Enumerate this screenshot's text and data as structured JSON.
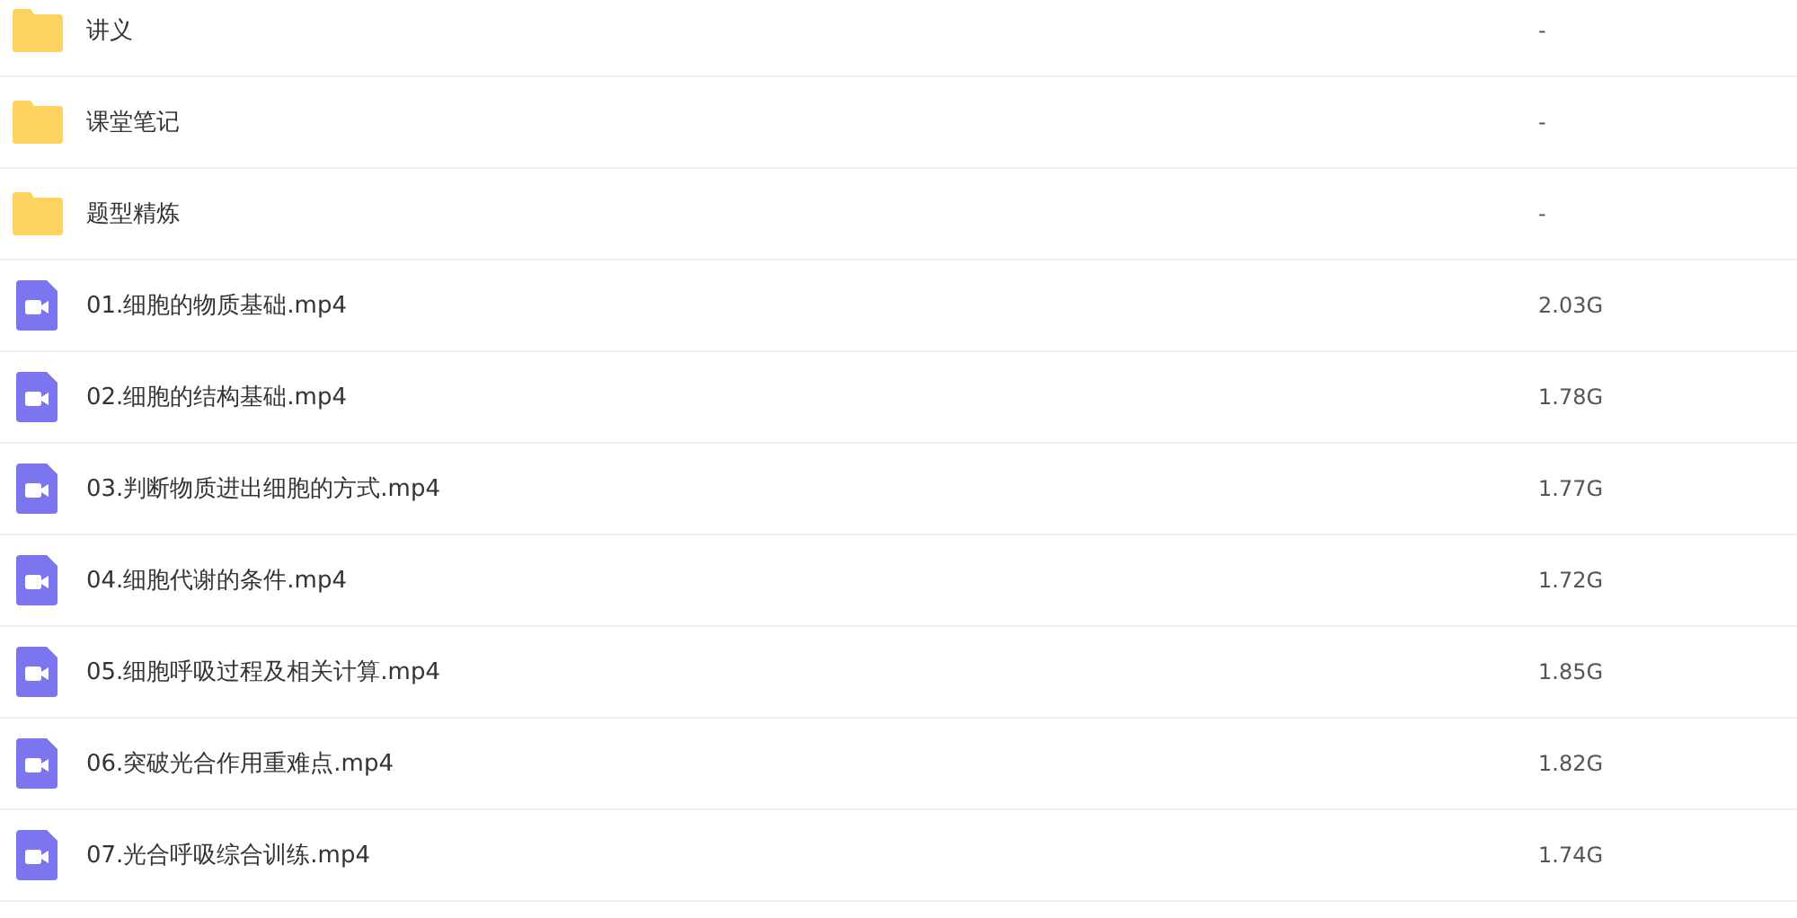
{
  "files": [
    {
      "kind": "folder",
      "name": "讲义",
      "size": "-"
    },
    {
      "kind": "folder",
      "name": "课堂笔记",
      "size": "-"
    },
    {
      "kind": "folder",
      "name": "题型精炼",
      "size": "-"
    },
    {
      "kind": "video",
      "name": "01.细胞的物质基础.mp4",
      "size": "2.03G"
    },
    {
      "kind": "video",
      "name": "02.细胞的结构基础.mp4",
      "size": "1.78G"
    },
    {
      "kind": "video",
      "name": "03.判断物质进出细胞的方式.mp4",
      "size": "1.77G"
    },
    {
      "kind": "video",
      "name": "04.细胞代谢的条件.mp4",
      "size": "1.72G"
    },
    {
      "kind": "video",
      "name": "05.细胞呼吸过程及相关计算.mp4",
      "size": "1.85G"
    },
    {
      "kind": "video",
      "name": "06.突破光合作用重难点.mp4",
      "size": "1.82G"
    },
    {
      "kind": "video",
      "name": "07.光合呼吸综合训练.mp4",
      "size": "1.74G"
    }
  ]
}
